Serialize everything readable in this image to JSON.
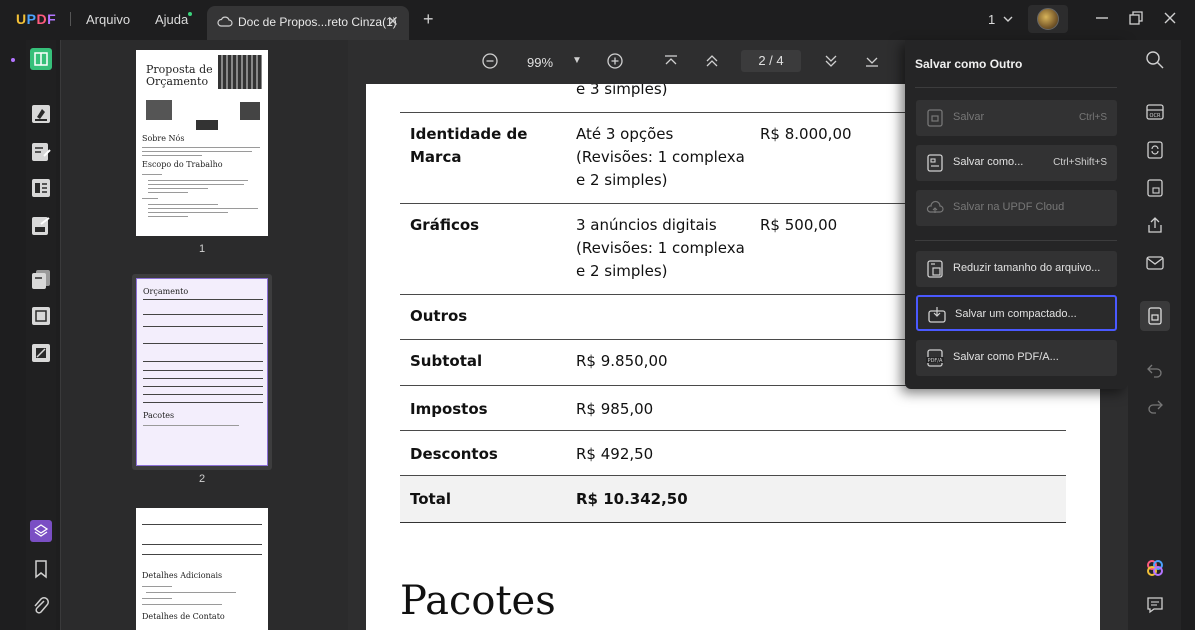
{
  "app": {
    "logo": "UPDF",
    "menus": [
      "Arquivo",
      "Ajuda"
    ],
    "tab_title": "Doc de Propos...reto Cinza(1)",
    "page_count_label": "1"
  },
  "toolbar": {
    "zoom": "99%",
    "current_page": "2",
    "total_pages": "4",
    "page_display": "2 / 4"
  },
  "thumbnails": {
    "labels": [
      "1",
      "2"
    ],
    "page1": {
      "title_line1": "Proposta de",
      "title_line2": "Orçamento",
      "section1": "Sobre Nós",
      "section2": "Escopo do Trabalho"
    },
    "page2": {
      "heading": "Orçamento",
      "footer_heading": "Pacotes"
    },
    "page3": {
      "heading": "Detalhes Adicionais",
      "heading2": "Detalhes de Contato"
    }
  },
  "document": {
    "rows": [
      {
        "item": "",
        "detail": "e 3 simples)",
        "price": ""
      },
      {
        "item": "Identidade de Marca",
        "detail": "Até 3 opções (Revisões: 1 complexa e 2 simples)",
        "price": "R$ 8.000,00"
      },
      {
        "item": "Gráficos",
        "detail": "3 anúncios digitais (Revisões: 1 complexa e 2 simples)",
        "price": "R$ 500,00"
      },
      {
        "item": "Outros",
        "detail": "",
        "price": ""
      },
      {
        "item": "Subtotal",
        "detail": "R$ 9.850,00",
        "price": ""
      },
      {
        "item": "Impostos",
        "detail": "R$ 985,00",
        "price": ""
      },
      {
        "item": "Descontos",
        "detail": "R$ 492,50",
        "price": ""
      },
      {
        "item": "Total",
        "detail": "R$ 10.342,50",
        "price": ""
      }
    ],
    "row_text": {
      "r0_detail": "e 3 simples)",
      "r1_item_a": "Identidade de",
      "r1_item_b": "Marca",
      "r1_detail_a": "Até 3 opções",
      "r1_detail_b": "(Revisões: 1 complexa",
      "r1_detail_c": "e 2 simples)",
      "r1_price": "R$ 8.000,00",
      "r2_item": "Gráficos",
      "r2_detail_a": "3 anúncios digitais",
      "r2_detail_b": "(Revisões: 1 complexa",
      "r2_detail_c": "e 2 simples)",
      "r2_price": "R$ 500,00",
      "r3_item": "Outros",
      "r4_item": "Subtotal",
      "r4_value": "R$ 9.850,00",
      "r5_item": "Impostos",
      "r5_value": "R$ 985,00",
      "r6_item": "Descontos",
      "r6_value": "R$ 492,50",
      "r7_item": "Total",
      "r7_value": "R$ 10.342,50"
    },
    "section_heading": "Pacotes"
  },
  "save_popup": {
    "title": "Salvar como Outro",
    "items": [
      {
        "label": "Salvar",
        "shortcut": "Ctrl+S",
        "enabled": false
      },
      {
        "label": "Salvar como...",
        "shortcut": "Ctrl+Shift+S",
        "enabled": true
      },
      {
        "label": "Salvar na UPDF Cloud",
        "shortcut": "",
        "enabled": false
      },
      {
        "label": "Reduzir tamanho do arquivo...",
        "shortcut": "",
        "enabled": true
      },
      {
        "label": "Salvar um compactado...",
        "shortcut": "",
        "enabled": true,
        "active": true
      },
      {
        "label": "Salvar como PDF/A...",
        "shortcut": "",
        "enabled": true
      }
    ]
  },
  "colors": {
    "accent": "#4a59ff",
    "logo_purple": "#b374ff"
  }
}
